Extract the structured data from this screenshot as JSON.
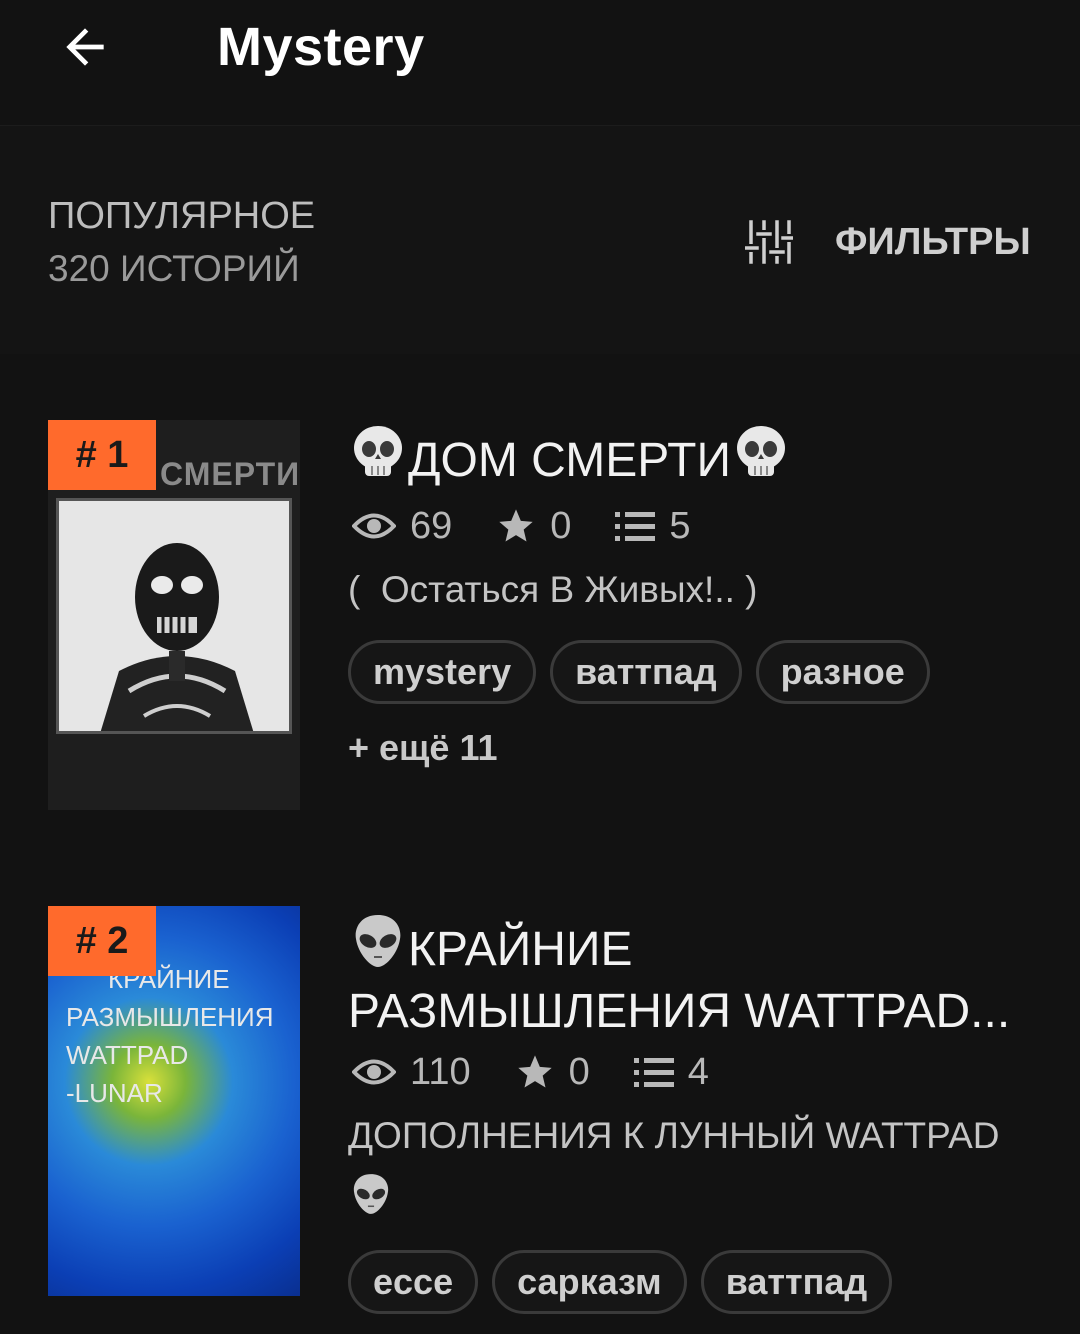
{
  "header": {
    "title": "Mystery",
    "back_icon": "arrow-left-icon"
  },
  "sort": {
    "label": "ПОПУЛЯРНОЕ",
    "count": "320 ИСТОРИЙ",
    "filters_label": "ФИЛЬТРЫ",
    "filters_icon": "sliders-icon"
  },
  "stories": [
    {
      "rank": "# 1",
      "cover_text": "СМЕРТИ",
      "title_emoji": "skull",
      "title": "ДОМ СМЕРТИ",
      "views": "69",
      "votes": "0",
      "parts": "5",
      "description": "(  Остаться В Живых!.. )",
      "tags": [
        "mystery",
        "ваттпад",
        "разное"
      ],
      "more_tags": "+ ещё 11"
    },
    {
      "rank": "# 2",
      "cover_lines": [
        "КРАЙНИЕ",
        "РАЗМЫШЛЕНИЯ",
        "WATTPAD",
        "-LUNAR"
      ],
      "title_emoji": "alien",
      "title_line1": "КРАЙНИЕ",
      "title_line2": "РАЗМЫШЛЕНИЯ WATTPAD...",
      "views": "110",
      "votes": "0",
      "parts": "4",
      "description": "ДОПОЛНЕНИЯ К ЛУННЫЙ WATTPAD",
      "tags": [
        "ecce",
        "сарказм",
        "ваттпад"
      ]
    }
  ],
  "colors": {
    "background": "#121212",
    "badge": "#ff6a2c",
    "text_primary": "#f2f2f2",
    "text_secondary": "#b8b8b8"
  }
}
